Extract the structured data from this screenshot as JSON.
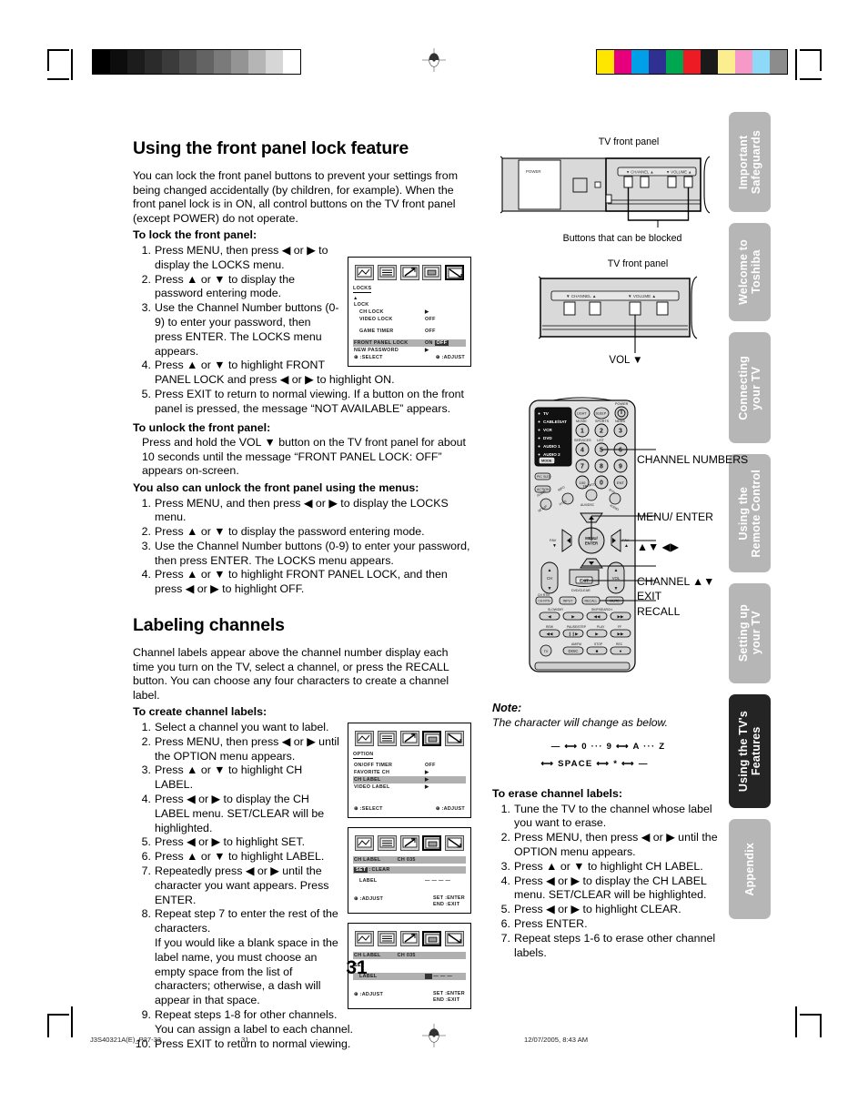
{
  "page": {
    "number": "31",
    "footer_left": "J3S40321A(E)_P27-33",
    "footer_center": "31",
    "footer_date": "12/07/2005, 8:43 AM"
  },
  "colorbars": {
    "gray": [
      "#000000",
      "#0d0d0d",
      "#1c1c1c",
      "#2b2b2b",
      "#3b3b3b",
      "#4f4f4f",
      "#636363",
      "#7a7a7a",
      "#949494",
      "#b5b5b5",
      "#d6d6d6",
      "#ffffff"
    ],
    "color": [
      "#ffe600",
      "#e6007e",
      "#00a0e9",
      "#2e3192",
      "#00a650",
      "#ed1c24",
      "#1a1a1a",
      "#fced8e",
      "#f799c8",
      "#8ed8f8",
      "#8c8c8c"
    ]
  },
  "tabs": [
    {
      "label": "Important\nSafeguards",
      "active": false,
      "height": 110
    },
    {
      "label": "Welcome to\nToshiba",
      "active": false,
      "height": 108
    },
    {
      "label": "Connecting\nyour TV",
      "active": false,
      "height": 122
    },
    {
      "label": "Using the\nRemote Control",
      "active": false,
      "height": 130
    },
    {
      "label": "Setting up\nyour TV",
      "active": false,
      "height": 110
    },
    {
      "label": "Using the TV's\nFeatures",
      "active": true,
      "height": 125
    },
    {
      "label": "Appendix",
      "active": false,
      "height": 110
    }
  ],
  "section1": {
    "title": "Using the front panel lock feature",
    "intro": "You can lock the front panel buttons to prevent your settings from being changed accidentally (by children, for example). When the front panel lock is in ON, all control buttons on the TV front panel (except POWER) do not operate.",
    "lockin_title": "To lock the front panel:",
    "lock_steps": [
      "Press MENU, then press ◀ or ▶ to display the LOCKS menu.",
      "Press ▲ or ▼ to display the password entering mode.",
      "Use the Channel Number buttons (0-9) to enter your password, then press ENTER. The LOCKS menu appears.",
      "Press ▲ or ▼ to highlight FRONT PANEL LOCK and press ◀ or ▶ to highlight ON.",
      "Press EXIT to return to normal viewing. If a button on the front panel is pressed, the message “NOT AVAILABLE” appears."
    ],
    "unlock_title": "To unlock the front panel:",
    "unlock_text": "Press and hold the VOL ▼ button on the TV front panel for about 10 seconds until the message “FRONT PANEL LOCK: OFF” appears on-screen.",
    "menus_title": "You also can unlock the front panel using the menus:",
    "menus_steps": [
      "Press MENU, and then press ◀ or ▶ to display the LOCKS menu.",
      "Press ▲ or ▼ to display the password entering mode.",
      "Use the Channel Number buttons (0-9) to enter your password, then press ENTER. The LOCKS menu appears.",
      "Press ▲ or ▼ to highlight FRONT PANEL LOCK, and then press ◀ or ▶ to highlight OFF."
    ]
  },
  "section2": {
    "title": "Labeling channels",
    "intro": "Channel labels appear above the channel number display each time you turn on the TV, select a channel, or press the RECALL button. You can choose any four characters to create a channel label.",
    "create_title": "To create channel labels:",
    "create_steps": [
      "Select a channel you want to label.",
      "Press MENU, then press ◀ or ▶ until the OPTION menu appears.",
      "Press ▲ or ▼ to highlight CH LABEL.",
      "Press ◀ or ▶ to display the CH LABEL menu. SET/CLEAR will be highlighted.",
      "Press ◀ or ▶ to highlight SET.",
      "Press ▲ or ▼ to highlight LABEL.",
      "Repeatedly press ◀ or ▶ until the character you want appears. Press ENTER.",
      "Repeat step 7 to enter the rest of the characters.",
      "Repeat steps 1-8 for other channels. You can assign a label to each channel.",
      "Press EXIT to return to normal viewing."
    ],
    "step8_note": "If you would like a blank space in the label name, you must choose an empty space from the list of characters; otherwise, a dash will appear in that space."
  },
  "osd_locks": {
    "heading": "LOCKS",
    "rows": [
      {
        "label": "LOCK",
        "value": "",
        "indent": false,
        "highlight": false
      },
      {
        "label": "CH LOCK",
        "value": "▶",
        "indent": true,
        "highlight": false
      },
      {
        "label": "VIDEO LOCK",
        "value": "OFF",
        "indent": true,
        "highlight": false
      },
      {
        "label": "GAME TIMER",
        "value": "OFF",
        "indent": true,
        "highlight": false
      }
    ],
    "row_front": {
      "label": "FRONT PANEL LOCK",
      "value_on": "ON",
      "value_off": "OFF"
    },
    "row_password": {
      "label": "NEW PASSWORD",
      "value": "▶"
    },
    "foot_left": "⊕ :SELECT",
    "foot_right": "⊕ :ADJUST"
  },
  "osd_option": {
    "heading": "OPTION",
    "rows": [
      {
        "label": "ON/OFF TIMER",
        "value": "OFF",
        "highlight": false
      },
      {
        "label": "FAVORITE CH",
        "value": "▶",
        "highlight": false
      },
      {
        "label": "CH LABEL",
        "value": "▶",
        "highlight": true
      },
      {
        "label": "VIDEO LABEL",
        "value": "▶",
        "highlight": false
      }
    ],
    "foot_left": "⊕ :SELECT",
    "foot_right": "⊕ :ADJUST"
  },
  "osd_chlabel1": {
    "heading": "CH LABEL",
    "heading_right": "CH 035",
    "row_setclear": {
      "set": "SET",
      "sep": ":",
      "clear": "CLEAR"
    },
    "row_label": {
      "label": "LABEL",
      "value": "— — — —"
    },
    "foot_left": "⊕ :ADJUST",
    "foot_right_1": "SET :ENTER",
    "foot_right_2": "END :EXIT"
  },
  "osd_chlabel2": {
    "heading": "CH LABEL",
    "heading_right": "CH 035",
    "row_set": "SET",
    "row_label": {
      "label": "LABEL",
      "value": "— — —"
    },
    "foot_left": "⊕ :ADJUST",
    "foot_right_1": "SET :ENTER",
    "foot_right_2": "END :EXIT"
  },
  "figure_tv1": {
    "caption_top": "TV front panel",
    "caption_bottom": "Buttons that can be blocked",
    "label_power": "POWER",
    "label_channel": "▼ CHANNEL ▲",
    "label_volume": "▼ VOLUME ▲"
  },
  "figure_tv2": {
    "caption_top": "TV front panel",
    "caption_bottom": "VOL ▼",
    "label_channel": "▼ CHANNEL ▲",
    "label_volume": "▼ VOLUME ▲"
  },
  "remote": {
    "callouts": [
      "CHANNEL NUMBERS",
      "MENU/ ENTER",
      "▲▼ ◀▶",
      "CHANNEL ▲▼",
      "EXIT",
      "RECALL"
    ],
    "mode_list": [
      "TV",
      "CABLE/SAT",
      "VCR",
      "DVD",
      "AUDIO 1",
      "AUDIO 2"
    ],
    "mode_button": "MODE",
    "power_label": "POWER",
    "keys_row_labels": [
      "MOVIE",
      "SPORTS",
      "NEWS",
      "SERVICES",
      "LIST"
    ],
    "numbers": [
      "1",
      "2",
      "3",
      "4",
      "5",
      "6",
      "7",
      "8",
      "9",
      "100",
      "0",
      "ENT"
    ],
    "top_keys": [
      "LIGHT",
      "SLEEP"
    ],
    "side_keys": [
      "PIC SIZE",
      "ACTION"
    ],
    "center_label": "MENU/ ENTER",
    "fav_down": "FAV ▼",
    "fav_up": "FAV ▲",
    "ch_label": "CH",
    "vol_label": "VOL",
    "exit_label": "EXIT",
    "dvd_clear": "DVD/CLEAR",
    "bottom_keys": [
      "CH RTN",
      "INPUT",
      "RECALL",
      "MUTE"
    ],
    "transport_labels": [
      "SLOW/DIR",
      "SKIP/SEARCH",
      "REW",
      "PAUSE/STEP",
      "PLAY",
      "FF",
      "AM/FM",
      "STOP",
      "REC",
      "DISC"
    ]
  },
  "note": {
    "title": "Note:",
    "subtitle": "The character will change as below.",
    "line1": "— ⟷ 0 ··· 9 ⟷ A ··· Z",
    "line2": "⟷ SPACE ⟷ * ⟷ —"
  },
  "erase": {
    "title": "To erase channel labels:",
    "steps": [
      "Tune the TV to the channel whose label you want to erase.",
      "Press MENU, then press ◀ or ▶ until the OPTION menu appears.",
      "Press ▲ or ▼ to highlight CH LABEL.",
      "Press ◀ or ▶ to display the CH LABEL menu. SET/CLEAR will be highlighted.",
      "Press ◀ or ▶ to highlight CLEAR.",
      "Press ENTER.",
      "Repeat steps 1-6 to erase other channel labels."
    ]
  }
}
